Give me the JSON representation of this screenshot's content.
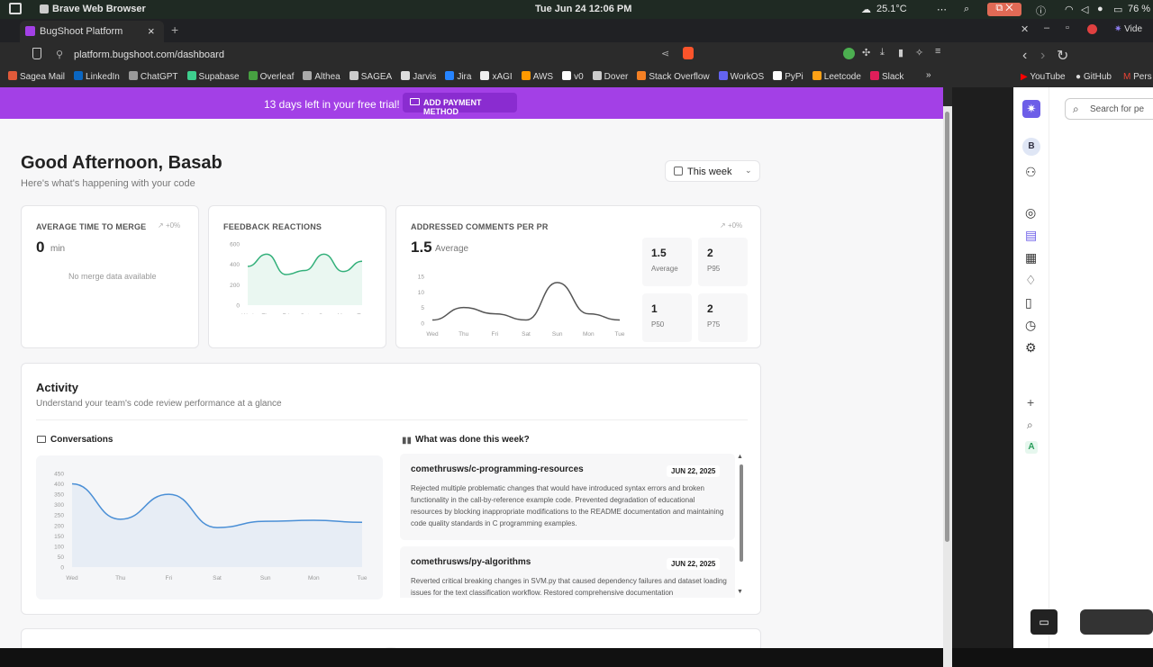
{
  "os": {
    "app": "Brave Web Browser",
    "datetime": "Tue Jun 24  12:06 PM",
    "temp": "25.1°C",
    "battery": "76 %"
  },
  "tab": {
    "title": "BugShoot Platform",
    "close": "×",
    "new": "+"
  },
  "url": "platform.bugshoot.com/dashboard",
  "bookmarks": [
    "Sagea Mail",
    "LinkedIn",
    "ChatGPT",
    "Supabase",
    "Overleaf",
    "Althea",
    "SAGEA",
    "Jarvis",
    "Jira",
    "xAGI",
    "AWS",
    "v0",
    "Dover",
    "Stack Overflow",
    "WorkOS",
    "PyPi",
    "Leetcode",
    "Slack"
  ],
  "bookmark_colors": [
    "#e05a3a",
    "#0a66c2",
    "#999",
    "#3ecf8e",
    "#47a141",
    "#aaa",
    "#ccc",
    "#ddd",
    "#2684ff",
    "#eee",
    "#ff9900",
    "#fff",
    "#ccc",
    "#f48024",
    "#6363f1",
    "#fff",
    "#ffa116",
    "#e01e5a"
  ],
  "banner": {
    "text": "13 days left in your free trial!",
    "button": "ADD PAYMENT METHOD"
  },
  "greeting": {
    "title": "Good Afternoon, Basab",
    "subtitle": "Here's what's happening with your code"
  },
  "range": {
    "value": "This week"
  },
  "merge": {
    "label": "AVERAGE TIME TO MERGE",
    "delta": "+0%",
    "value": "0",
    "unit": "min",
    "empty": "No merge data available"
  },
  "feedback": {
    "label": "FEEDBACK REACTIONS"
  },
  "comments": {
    "label": "ADDRESSED COMMENTS PER PR",
    "delta": "+0%",
    "value": "1.5",
    "unit": "Average",
    "stats": [
      {
        "v": "1.5",
        "l": "Average"
      },
      {
        "v": "2",
        "l": "P95"
      },
      {
        "v": "1",
        "l": "P50"
      },
      {
        "v": "2",
        "l": "P75"
      }
    ]
  },
  "activity": {
    "title": "Activity",
    "subtitle": "Understand your team's code review performance at a glance",
    "conv_title": "Conversations",
    "done_title": "What was done this week?",
    "items": [
      {
        "repo": "comethrusws/c-programming-resources",
        "date": "JUN 22, 2025",
        "desc": "Rejected multiple problematic changes that would have introduced syntax errors and broken functionality in the call-by-reference example code. Prevented degradation of educational resources by blocking inappropriate modifications to the README documentation and maintaining code quality standards in C programming examples."
      },
      {
        "repo": "comethrusws/py-algorithms",
        "date": "JUN 22, 2025",
        "desc": "Reverted critical breaking changes in SVM.py that caused dependency failures and dataset loading issues for the text classification workflow. Restored comprehensive documentation"
      }
    ]
  },
  "right": {
    "search": "Search for pe",
    "links": [
      "YouTube",
      "GitHub",
      "Pers"
    ],
    "title": "Vide",
    "avatar": "B",
    "a": "A"
  },
  "chart_data": [
    {
      "type": "area",
      "title": "FEEDBACK REACTIONS",
      "categories": [
        "Wed",
        "Thu",
        "Fri",
        "Sat",
        "Sun",
        "Mon",
        "Tue"
      ],
      "values": [
        380,
        500,
        300,
        340,
        500,
        330,
        430
      ],
      "ylim": [
        0,
        600
      ],
      "yticks": [
        0,
        200,
        400,
        600
      ]
    },
    {
      "type": "line",
      "title": "ADDRESSED COMMENTS PER PR",
      "categories": [
        "Wed",
        "Thu",
        "Fri",
        "Sat",
        "Sun",
        "Mon",
        "Tue"
      ],
      "values": [
        1,
        5,
        3,
        1,
        13,
        3,
        1
      ],
      "ylim": [
        0,
        15
      ],
      "yticks": [
        0,
        5,
        10,
        15
      ]
    },
    {
      "type": "area",
      "title": "Conversations",
      "categories": [
        "Wed",
        "Thu",
        "Fri",
        "Sat",
        "Sun",
        "Mon",
        "Tue"
      ],
      "values": [
        400,
        230,
        350,
        190,
        220,
        225,
        215
      ],
      "ylim": [
        0,
        450
      ],
      "yticks": [
        0,
        50,
        100,
        150,
        200,
        250,
        300,
        350,
        400,
        450
      ]
    }
  ]
}
